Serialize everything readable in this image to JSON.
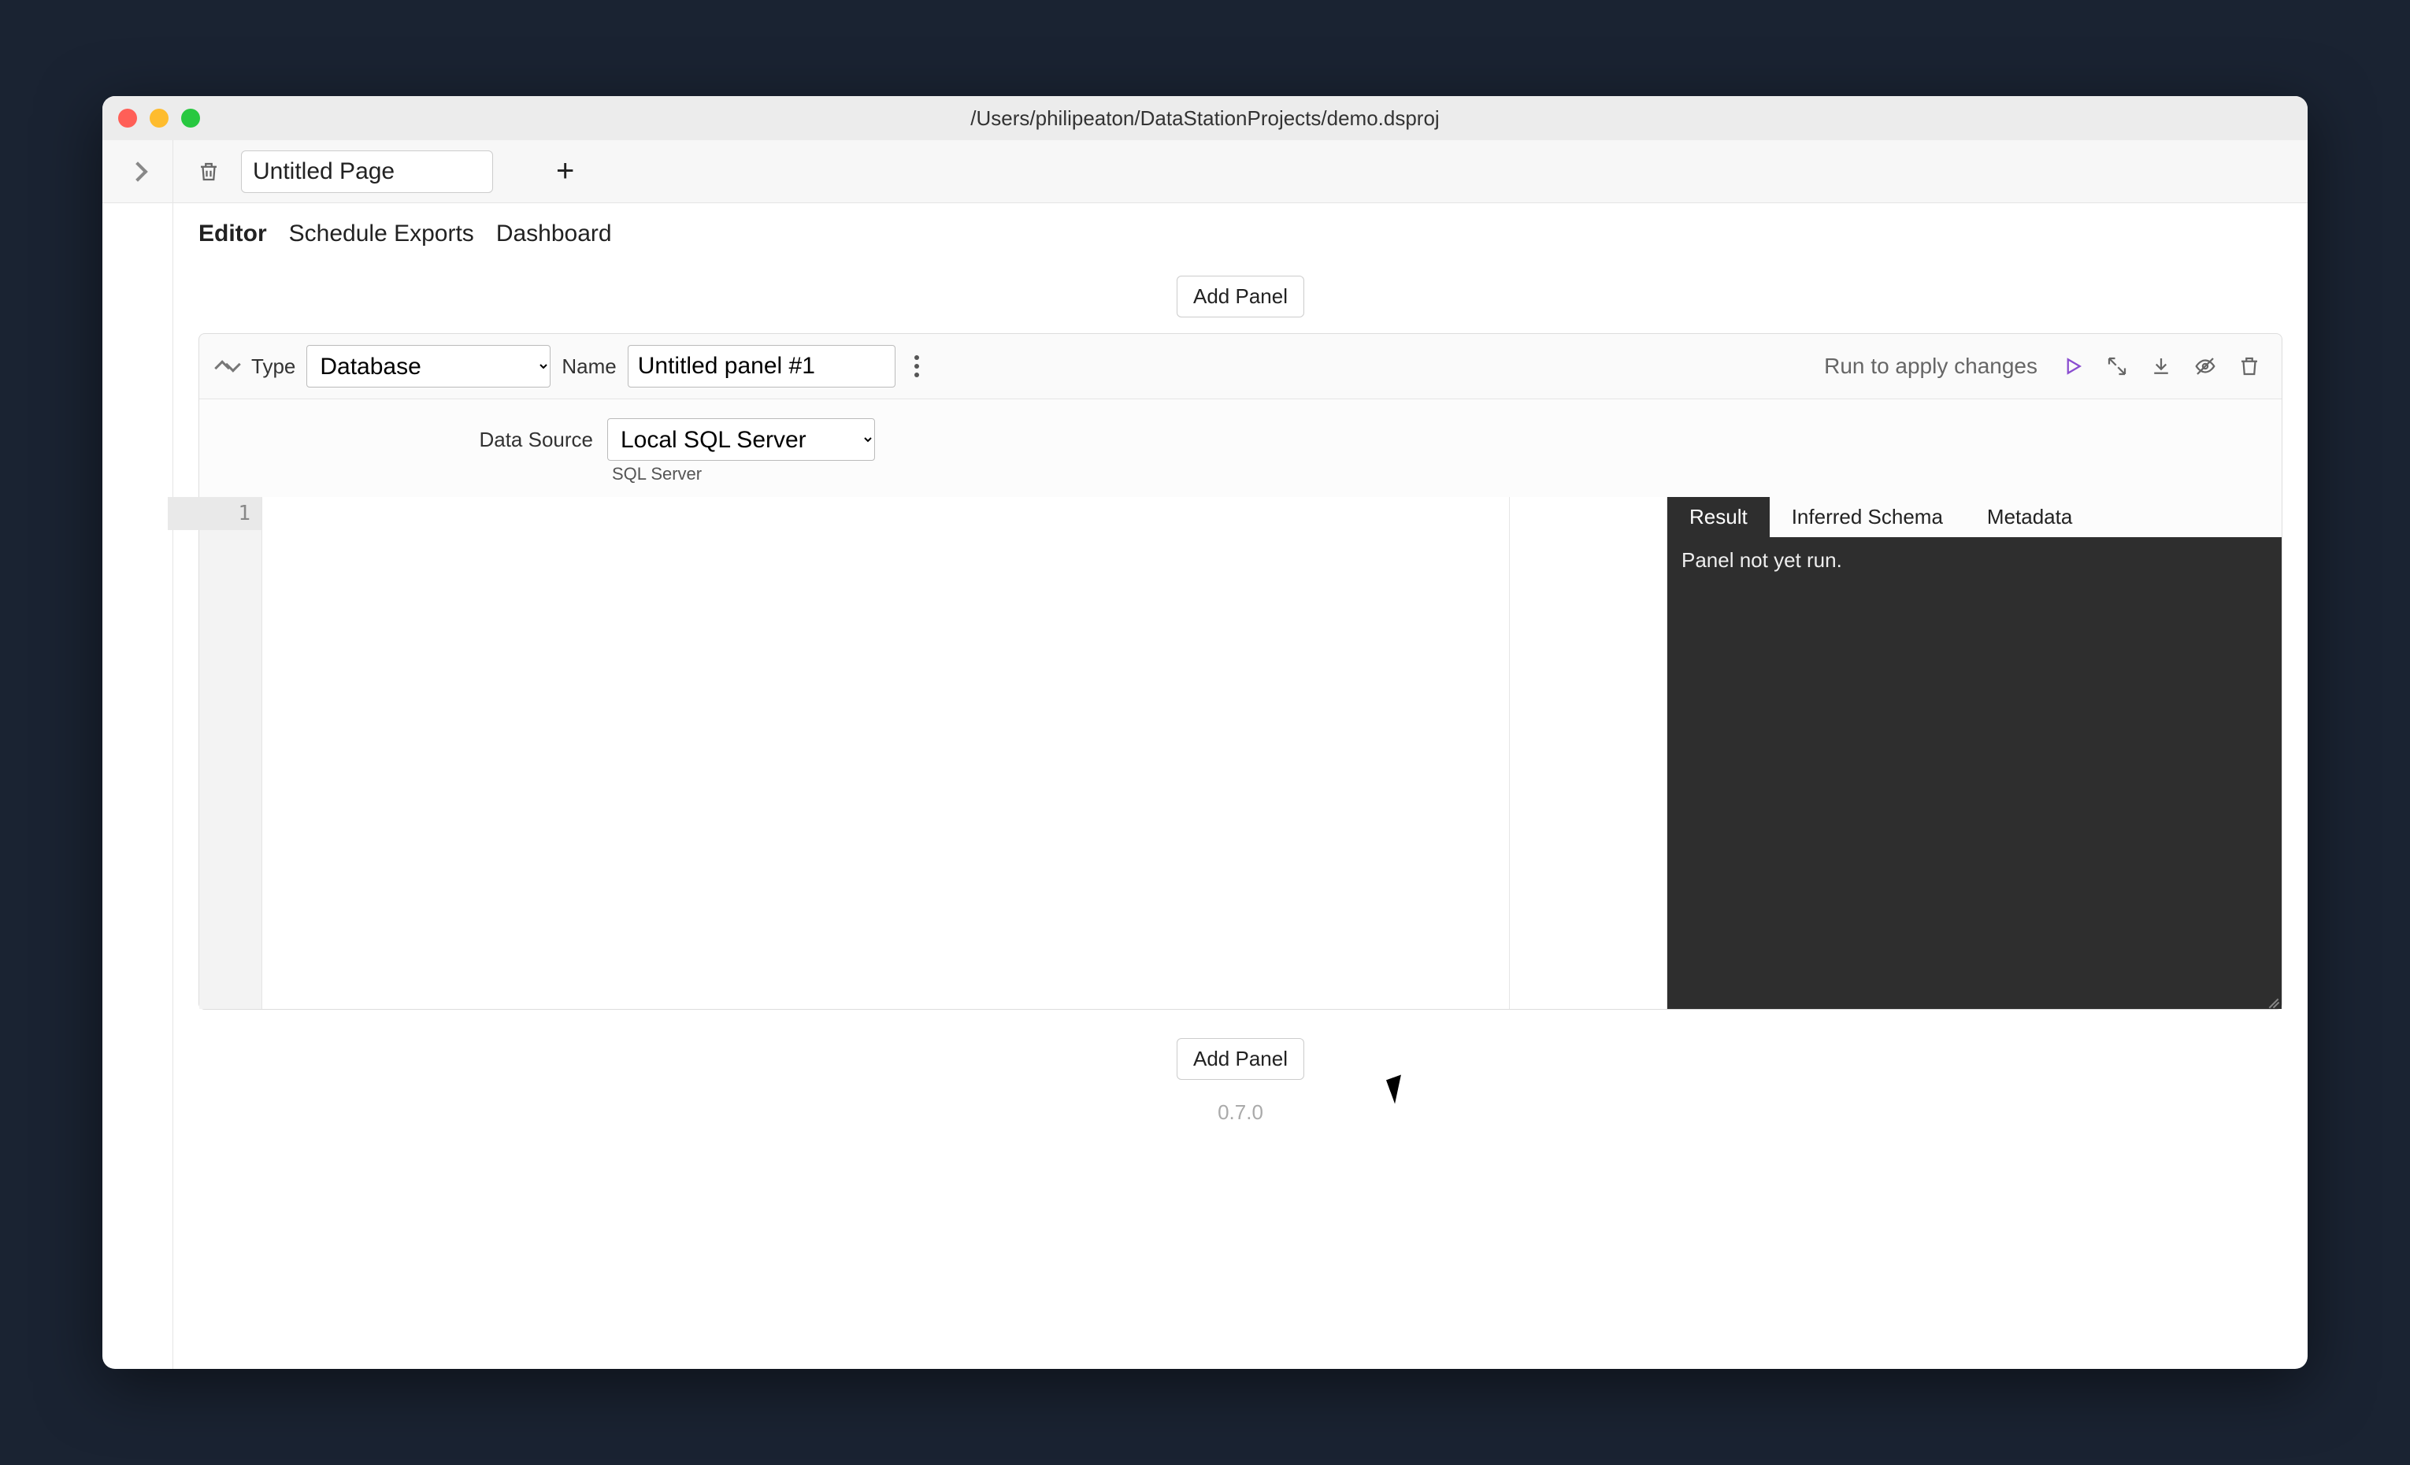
{
  "window": {
    "title": "/Users/philipeaton/DataStationProjects/demo.dsproj"
  },
  "toolbar": {
    "page_name": "Untitled Page"
  },
  "tabs": {
    "editor": "Editor",
    "schedule_exports": "Schedule Exports",
    "dashboard": "Dashboard"
  },
  "buttons": {
    "add_panel": "Add Panel"
  },
  "panel": {
    "type_label": "Type",
    "type_value": "Database",
    "name_label": "Name",
    "name_value": "Untitled panel #1",
    "run_hint": "Run to apply changes",
    "data_source_label": "Data Source",
    "data_source_value": "Local SQL Server",
    "data_source_sub": "SQL Server",
    "gutter_line": "1"
  },
  "result": {
    "tab_result": "Result",
    "tab_schema": "Inferred Schema",
    "tab_metadata": "Metadata",
    "message": "Panel not yet run."
  },
  "footer": {
    "version": "0.7.0"
  }
}
